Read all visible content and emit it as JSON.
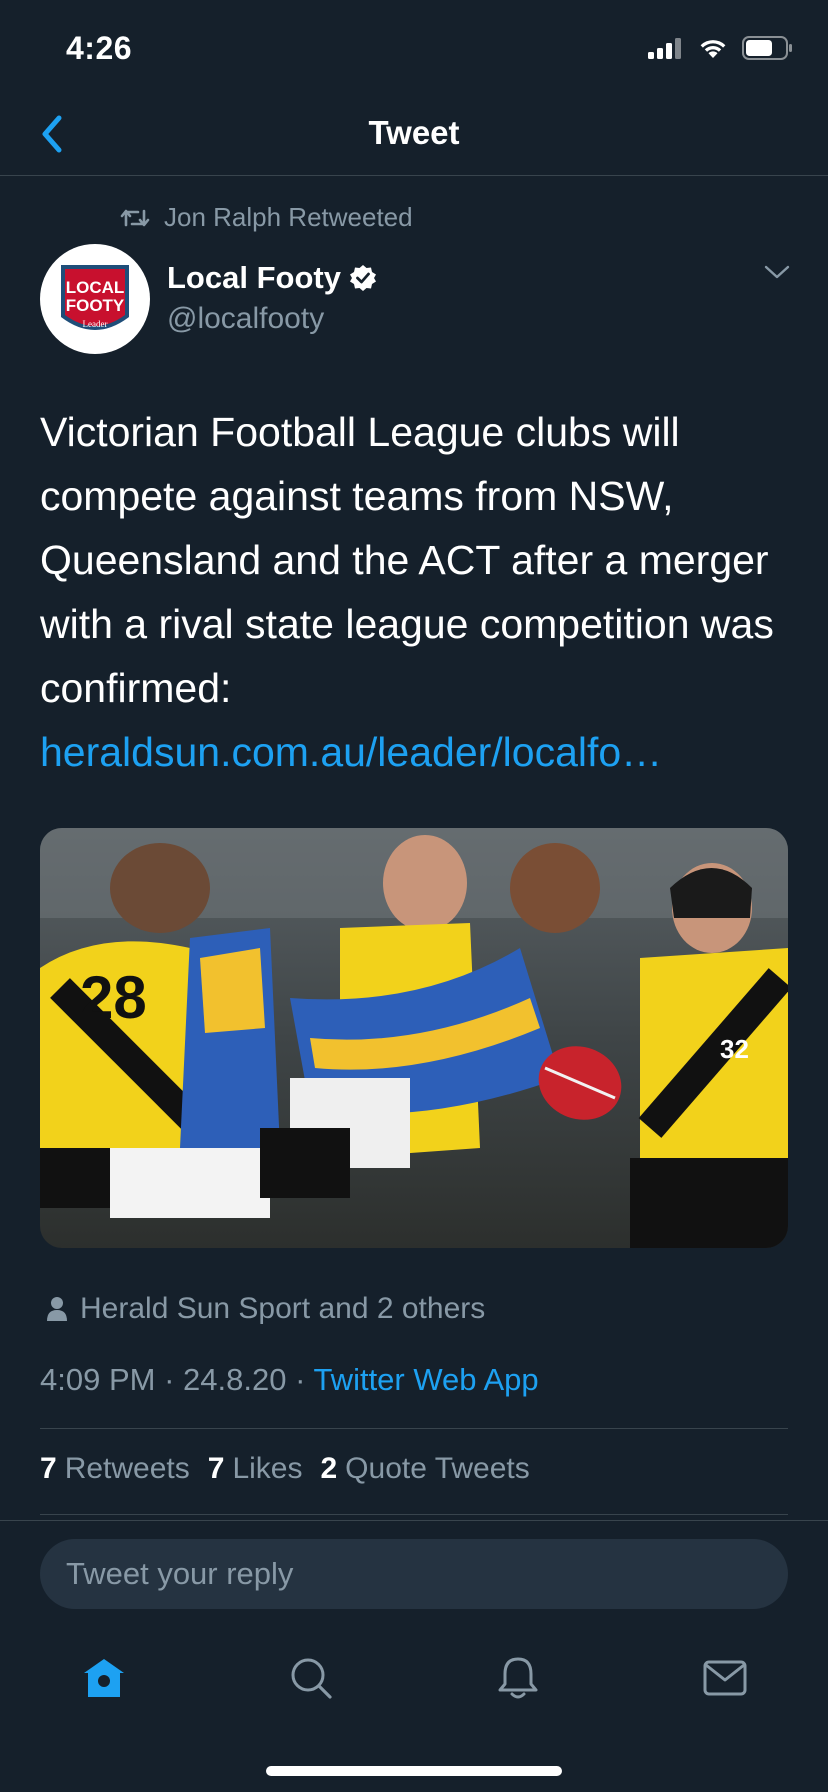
{
  "status_bar": {
    "time": "4:26"
  },
  "nav": {
    "title": "Tweet"
  },
  "retweet_header": {
    "text": "Jon Ralph Retweeted"
  },
  "author": {
    "name": "Local Footy",
    "handle": "@localfooty",
    "avatar_text_1": "LOCAL",
    "avatar_text_2": "FOOTY",
    "avatar_text_3": "Leader"
  },
  "tweet": {
    "text": "Victorian Football League clubs will compete against teams from NSW, Queensland and the ACT after a merger with a rival state league competition was confirmed:",
    "link": "heraldsun.com.au/leader/localfo…"
  },
  "tagged": {
    "text": "Herald Sun Sport and 2 others"
  },
  "meta": {
    "time": "4:09 PM",
    "sep1": " · ",
    "date": "24.8.20",
    "sep2": " · ",
    "source": "Twitter Web App"
  },
  "stats": [
    {
      "count": "7",
      "label": "Retweets"
    },
    {
      "count": "7",
      "label": "Likes"
    },
    {
      "count": "2",
      "label": "Quote Tweets"
    }
  ],
  "reply": {
    "placeholder": "Tweet your reply"
  },
  "tabs": [
    {
      "icon": "home-icon",
      "active": true
    },
    {
      "icon": "search-icon",
      "active": false
    },
    {
      "icon": "bell-icon",
      "active": false
    },
    {
      "icon": "mail-icon",
      "active": false
    }
  ],
  "colors": {
    "accent": "#1da1f2",
    "background": "#15202b",
    "muted": "#8899a6",
    "border": "#38444d"
  }
}
